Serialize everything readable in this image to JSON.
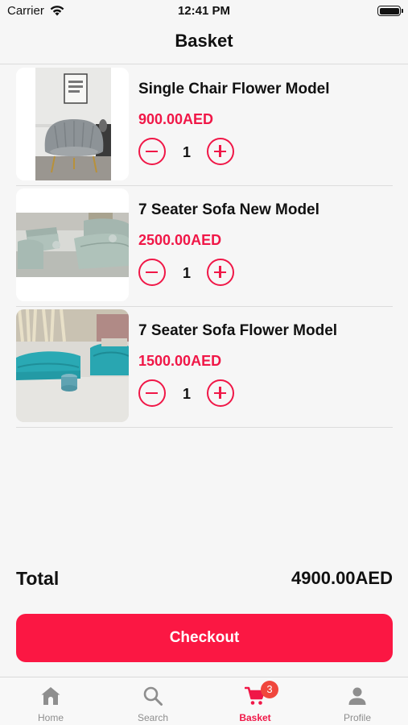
{
  "status_bar": {
    "carrier": "Carrier",
    "time": "12:41 PM"
  },
  "header": {
    "title": "Basket"
  },
  "cart": {
    "items": [
      {
        "name": "Single Chair Flower Model",
        "price": "900.00AED",
        "quantity": "1"
      },
      {
        "name": "7 Seater Sofa New Model",
        "price": "2500.00AED",
        "quantity": "1"
      },
      {
        "name": "7 Seater Sofa Flower Model",
        "price": "1500.00AED",
        "quantity": "1"
      }
    ]
  },
  "summary": {
    "total_label": "Total",
    "total_value": "4900.00AED"
  },
  "checkout": {
    "label": "Checkout"
  },
  "tabbar": {
    "tabs": [
      {
        "label": "Home",
        "icon": "home-icon"
      },
      {
        "label": "Search",
        "icon": "search-icon"
      },
      {
        "label": "Basket",
        "icon": "cart-icon",
        "badge": "3",
        "active": true
      },
      {
        "label": "Profile",
        "icon": "person-icon"
      }
    ]
  },
  "colors": {
    "accent": "#f01747",
    "checkout": "#fb1743",
    "badge": "#f0473d",
    "inactive": "#8e8e8e"
  }
}
